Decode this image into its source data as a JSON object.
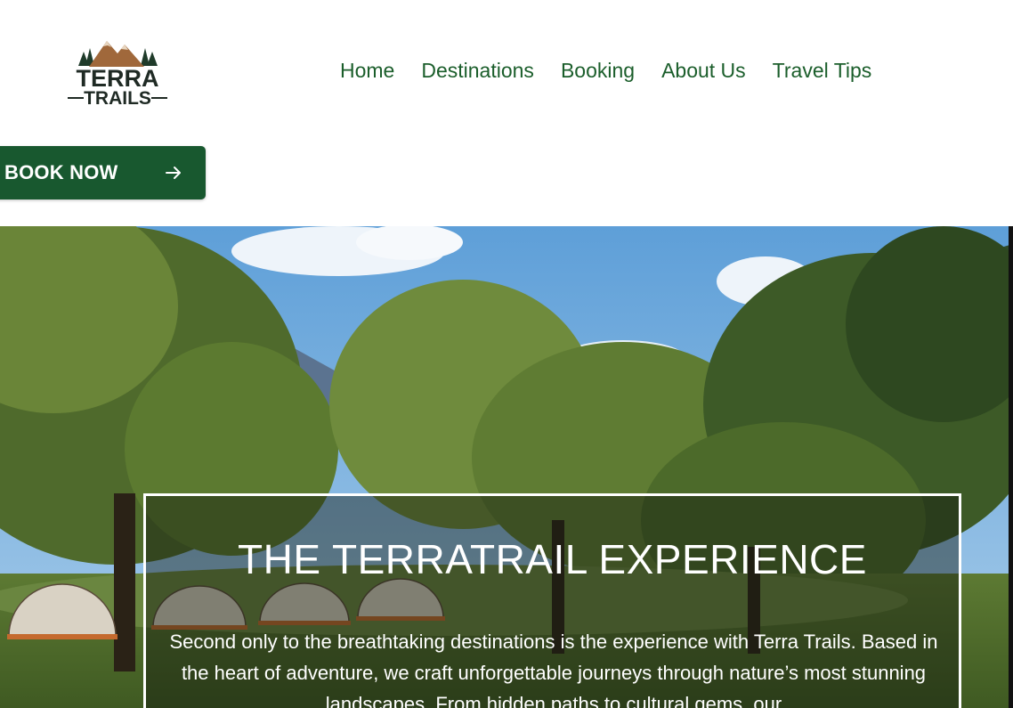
{
  "brand": {
    "logo_line1": "TERRA",
    "logo_line2": "TRAILS"
  },
  "nav": {
    "items": [
      {
        "label": "Home"
      },
      {
        "label": "Destinations"
      },
      {
        "label": "Booking"
      },
      {
        "label": "About Us"
      },
      {
        "label": "Travel Tips"
      }
    ]
  },
  "cta": {
    "label": "BOOK NOW",
    "icon": "arrow-right-icon"
  },
  "hero": {
    "title": "THE TERRATRAIL EXPERIENCE",
    "text": "Second only to the breathtaking destinations is the experience with Terra Trails. Based in the heart of adventure, we craft unforgettable journeys through nature’s most stunning landscapes. From hidden paths to cultural gems, our"
  },
  "colors": {
    "brand_green": "#18582f",
    "nav_green": "#1b5e2b",
    "logo_brown": "#a0683b",
    "logo_dark": "#1f2a24"
  }
}
